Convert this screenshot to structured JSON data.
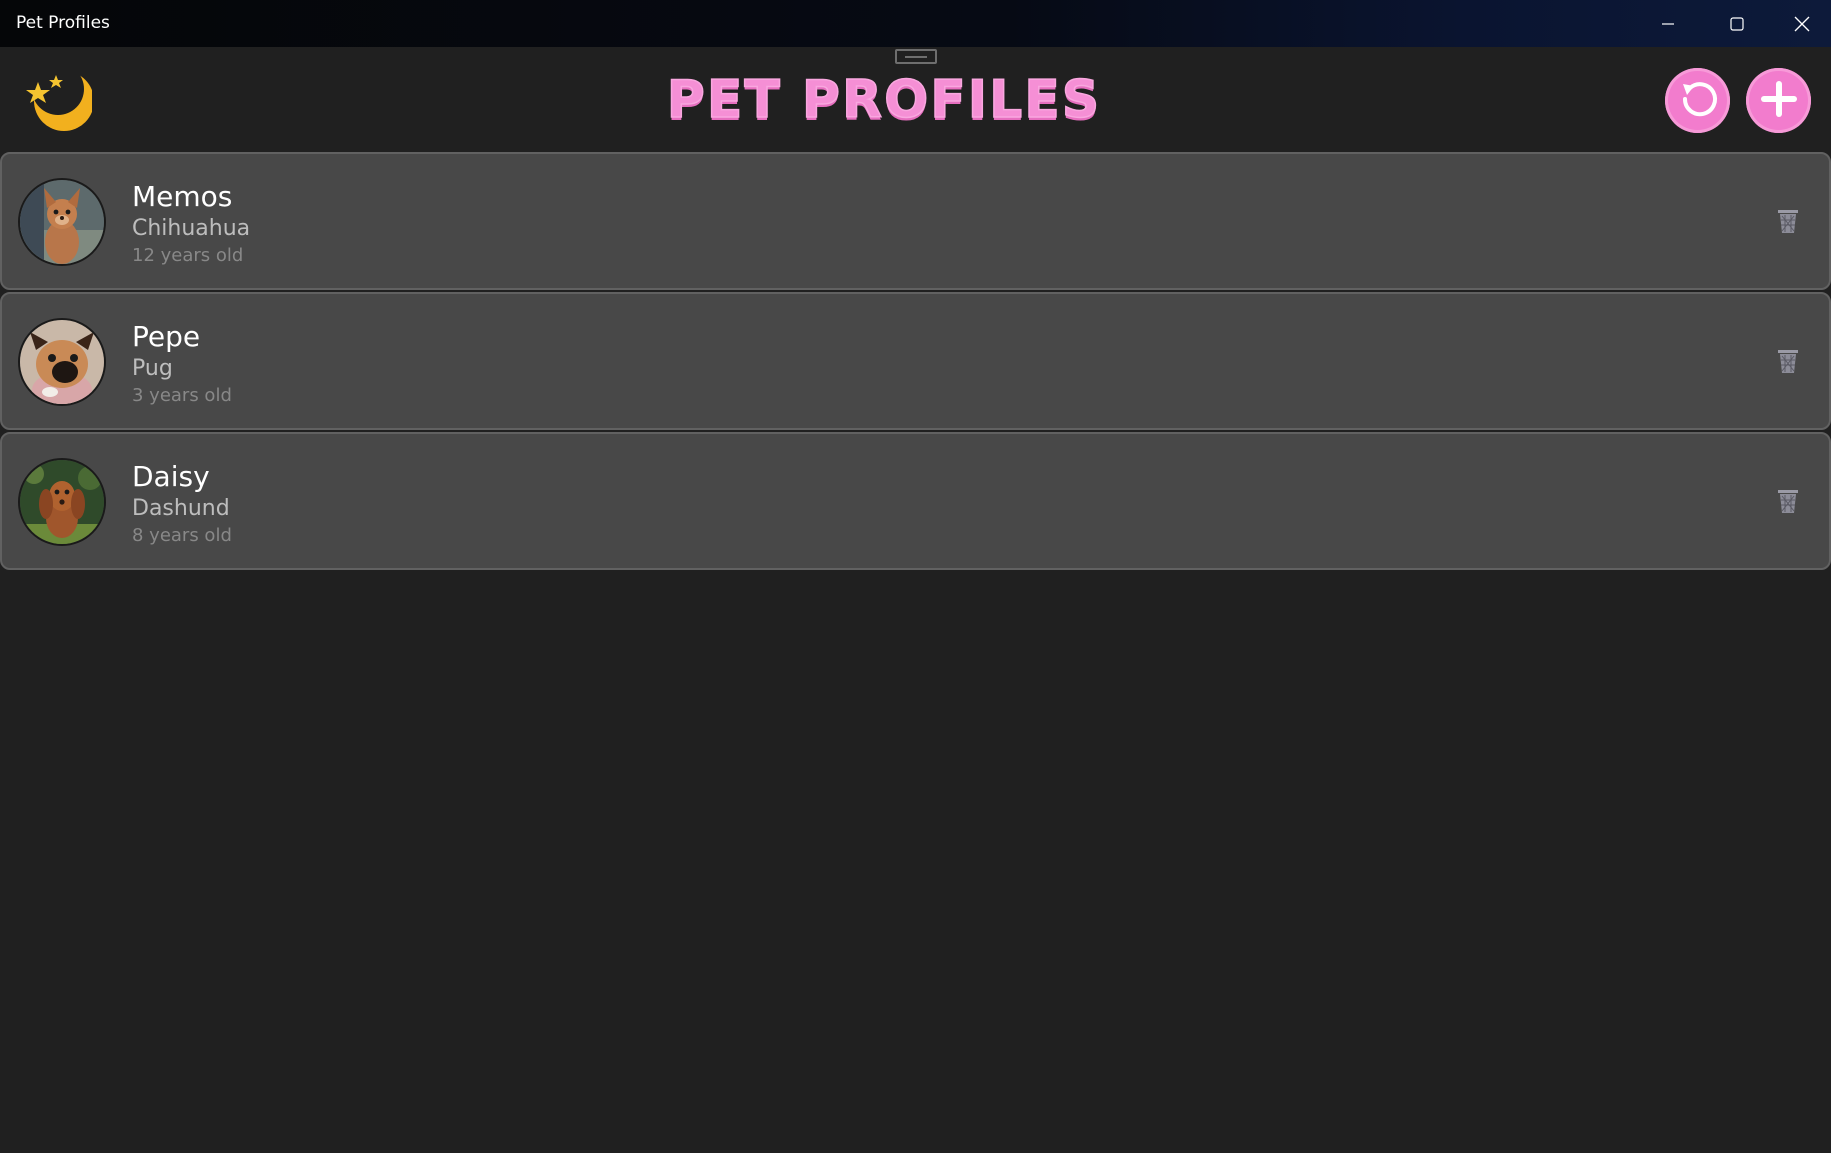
{
  "window": {
    "title": "Pet Profiles",
    "controls": {
      "minimize_icon": "minimize-icon",
      "maximize_icon": "maximize-icon",
      "close_icon": "close-icon"
    }
  },
  "header": {
    "title": "PET PROFILES",
    "theme_icon": "crescent-moon-stars-icon",
    "refresh_icon": "refresh-icon",
    "add_icon": "plus-icon",
    "accent_color": "#f27ccd"
  },
  "pets": [
    {
      "name": "Memos",
      "breed": "Chihuahua",
      "age": "12 years old",
      "avatar_icon": "chihuahua-photo",
      "delete_icon": "trash-icon"
    },
    {
      "name": "Pepe",
      "breed": "Pug",
      "age": "3 years old",
      "avatar_icon": "pug-photo",
      "delete_icon": "trash-icon"
    },
    {
      "name": "Daisy",
      "breed": "Dashund",
      "age": "8 years old",
      "avatar_icon": "dachshund-photo",
      "delete_icon": "trash-icon"
    }
  ]
}
